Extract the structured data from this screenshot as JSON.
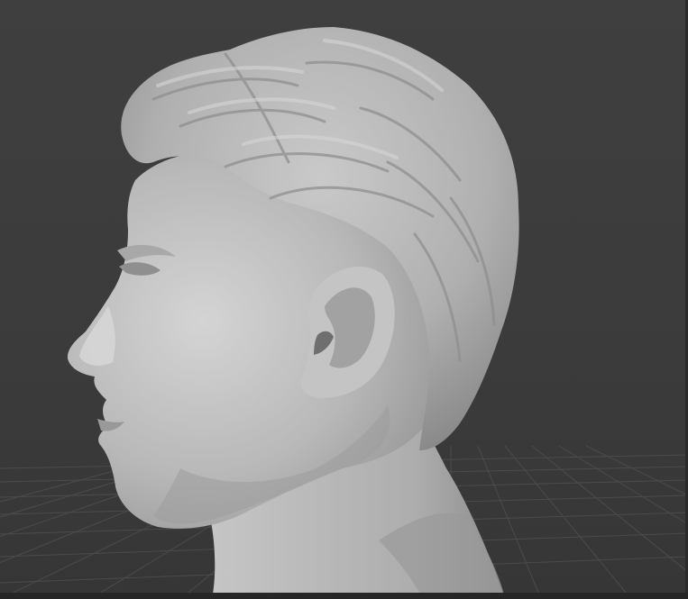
{
  "scene": {
    "background_color": "#3d3d3d",
    "grid_color": "#4a4a4a",
    "model_color": "#bdbdbd",
    "model_name_icon": "sculpted-head-icon"
  }
}
